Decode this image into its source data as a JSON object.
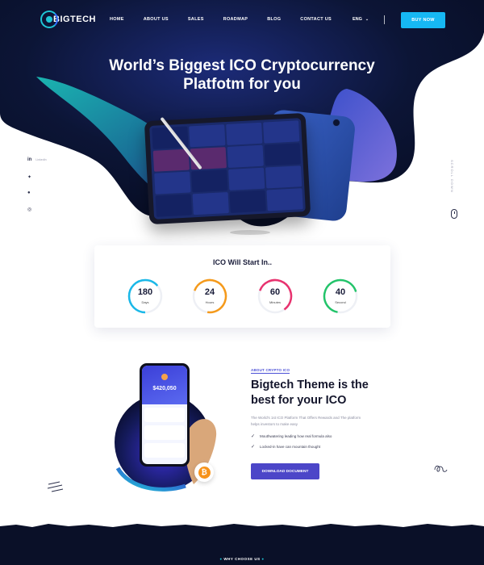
{
  "brand": {
    "logo_text": "BIGTECH"
  },
  "nav": {
    "items": [
      "HOME",
      "ABOUT US",
      "SALES",
      "ROADMAP",
      "BLOG",
      "CONTACT US"
    ],
    "language": "ENG",
    "buy_label": "BUY NOW"
  },
  "hero": {
    "title_line1": "World’s Biggest ICO Cryptocurrency",
    "title_line2": "Platfotm for you"
  },
  "social": {
    "items": [
      {
        "icon": "linkedin-icon",
        "glyph": "in",
        "label": "LinkedIn"
      },
      {
        "icon": "twitter-icon",
        "glyph": "🐦",
        "label": ""
      },
      {
        "icon": "pinterest-icon",
        "glyph": "℗",
        "label": ""
      },
      {
        "icon": "dribbble-icon",
        "glyph": "◎",
        "label": ""
      }
    ],
    "scroll_label": "SCROLL DOWN"
  },
  "countdown": {
    "title": "ICO Will Start In..",
    "timers": [
      {
        "value": "180",
        "unit": "Days",
        "color": "#1ab8e8"
      },
      {
        "value": "24",
        "unit": "Hours",
        "color": "#f59a1b"
      },
      {
        "value": "60",
        "unit": "Minutes",
        "color": "#e8336f"
      },
      {
        "value": "40",
        "unit": "Second",
        "color": "#23c46a"
      }
    ]
  },
  "about": {
    "tag": "ABOUT CRYPTO ICO",
    "title": "Bigtech Theme is the best for your ICO",
    "description": "The World's 1st ICO Platform That Offers Rewards and The platform helps investors to make easy",
    "points": [
      "Mouthwatering leading how real formula also",
      "Locked-in have can mountain thought"
    ],
    "download_label": "DOWNLOAD DOCUMENT",
    "phone_amount": "$420,050",
    "btc_symbol": "₿"
  },
  "footer_band": {
    "why_label": "WHY CHOOSE US"
  },
  "colors": {
    "accent": "#16b8f3",
    "primary": "#4c46c8",
    "teal": "#1fc5d6",
    "dark": "#0a1028"
  }
}
